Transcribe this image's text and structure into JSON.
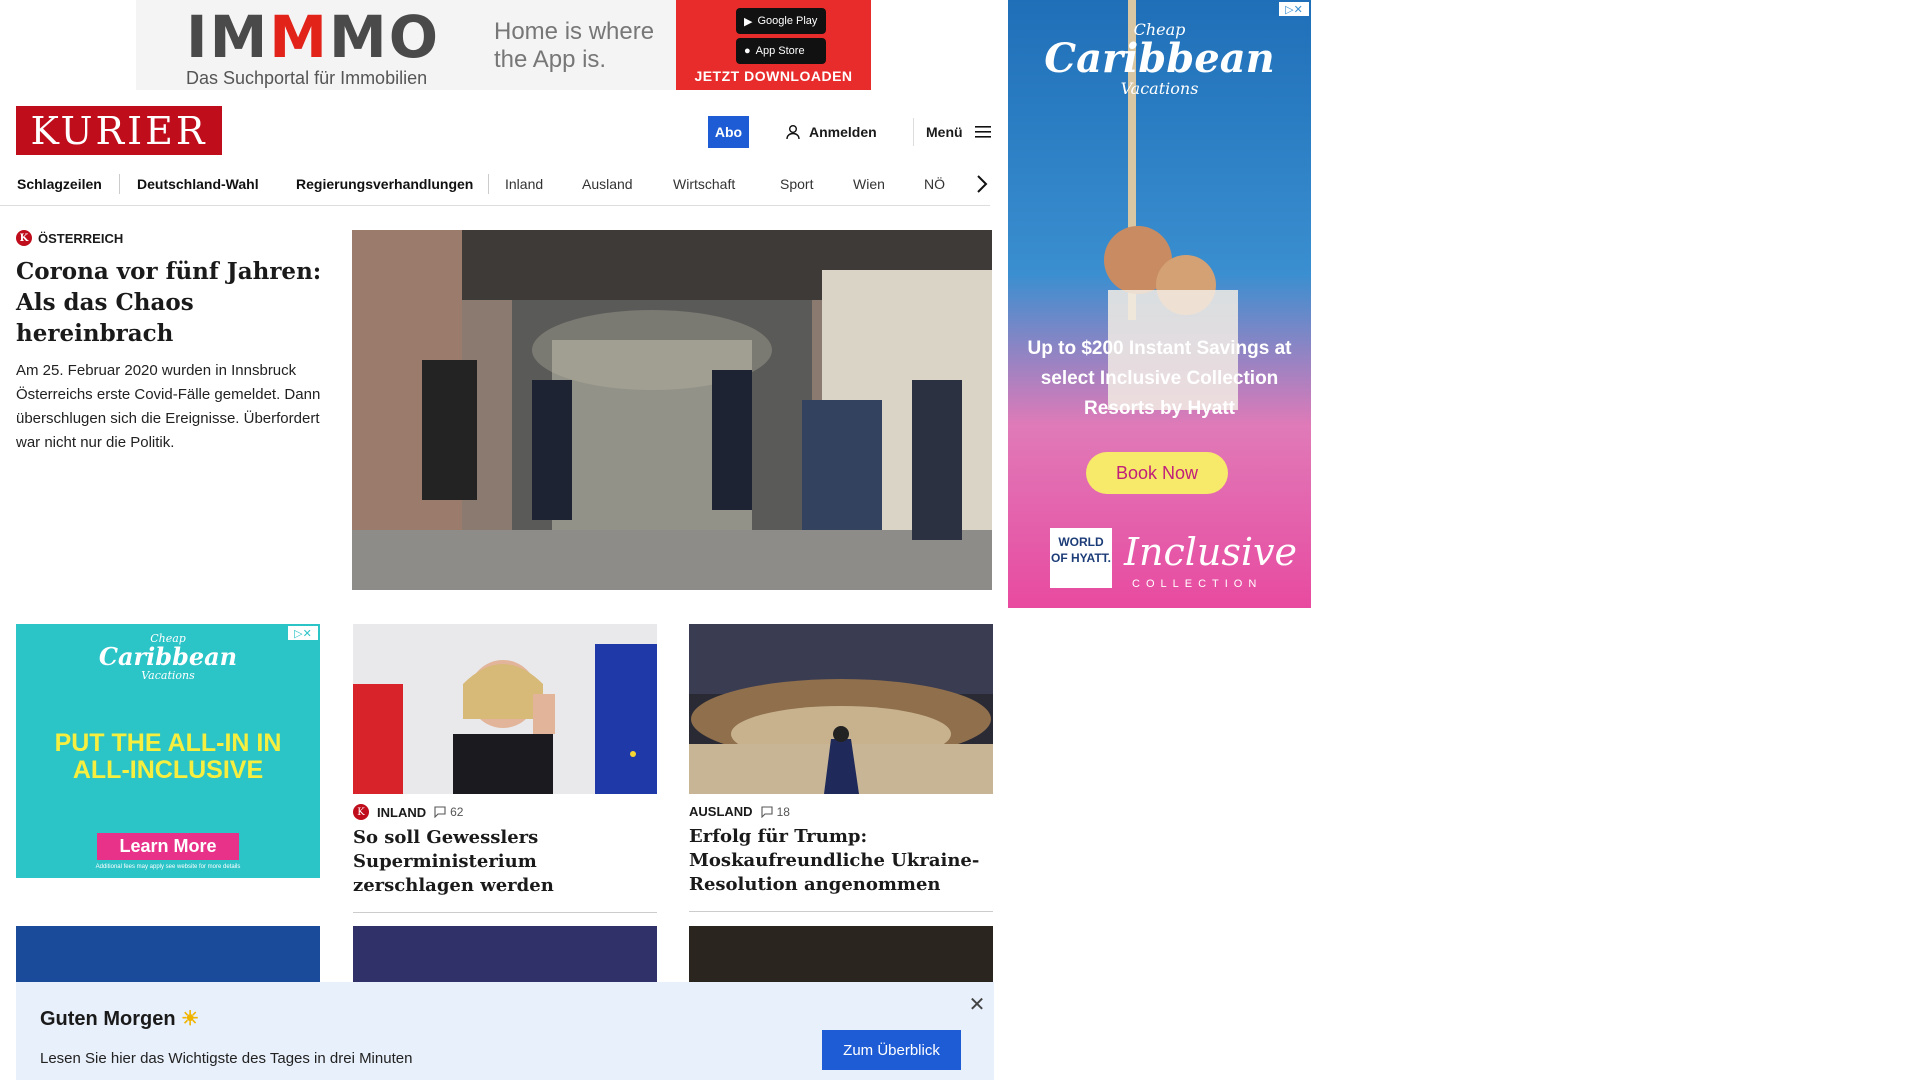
{
  "top_ad": {
    "brand_a": "IM",
    "brand_b": "M",
    "brand_c": "MO",
    "brand_sub": "Das Suchportal für Immobilien",
    "slogan": "Home is where the App is.",
    "store_google": "Google Play",
    "store_apple": "App Store",
    "cta": "JETZT DOWNLOADEN"
  },
  "header": {
    "logo": "KURIER",
    "abo": "Abo",
    "login": "Anmelden",
    "menu": "Menü"
  },
  "nav": {
    "items": [
      "Schlagzeilen",
      "Deutschland-Wahl",
      "Regierungsverhandlungen",
      "Inland",
      "Ausland",
      "Wirtschaft",
      "Sport",
      "Wien",
      "NÖ"
    ]
  },
  "lead": {
    "category": "Österreich",
    "title": "Corona vor fünf Jahren: Als das Chaos hereinbrach",
    "teaser": "Am 25. Februar 2020 wurden in Innsbruck Österreichs erste Covid-Fälle gemeldet. Dann überschlugen sich die Ereignisse. Überfordert war nicht nur die Politik."
  },
  "side_ad": {
    "brand_top": "Cheap",
    "brand": "Caribbean",
    "brand_bottom": "Vacations",
    "offer": "Up to $200 Instant Savings at select Inclusive Collection Resorts by Hyatt",
    "cta": "Book Now",
    "hyatt": "WORLD OF HYATT.",
    "inclusive": "Inclusive",
    "collection": "COLLECTION"
  },
  "grid_ad": {
    "brand_top": "Cheap",
    "brand": "Caribbean",
    "brand_bottom": "Vacations",
    "headline": "PUT THE ALL-IN IN ALL-INCLUSIVE",
    "cta": "Learn More",
    "fine": "Additional fees may apply see website for more details"
  },
  "cards": [
    {
      "category": "Inland",
      "comments": "62",
      "title": "So soll Gewesslers Superministerium zerschlagen werden"
    },
    {
      "category": "Ausland",
      "comments": "18",
      "title": "Erfolg für Trump: Moskaufreundliche Ukraine-Resolution angenommen"
    }
  ],
  "morning": {
    "title": "Guten Morgen",
    "desc": "Lesen Sie hier das Wichtigste des Tages in drei Minuten",
    "cta": "Zum Überblick"
  },
  "colors": {
    "brand_red": "#c00d1c",
    "accent_blue": "#1e5cd6",
    "morning_bg": "#e8f0fb"
  }
}
